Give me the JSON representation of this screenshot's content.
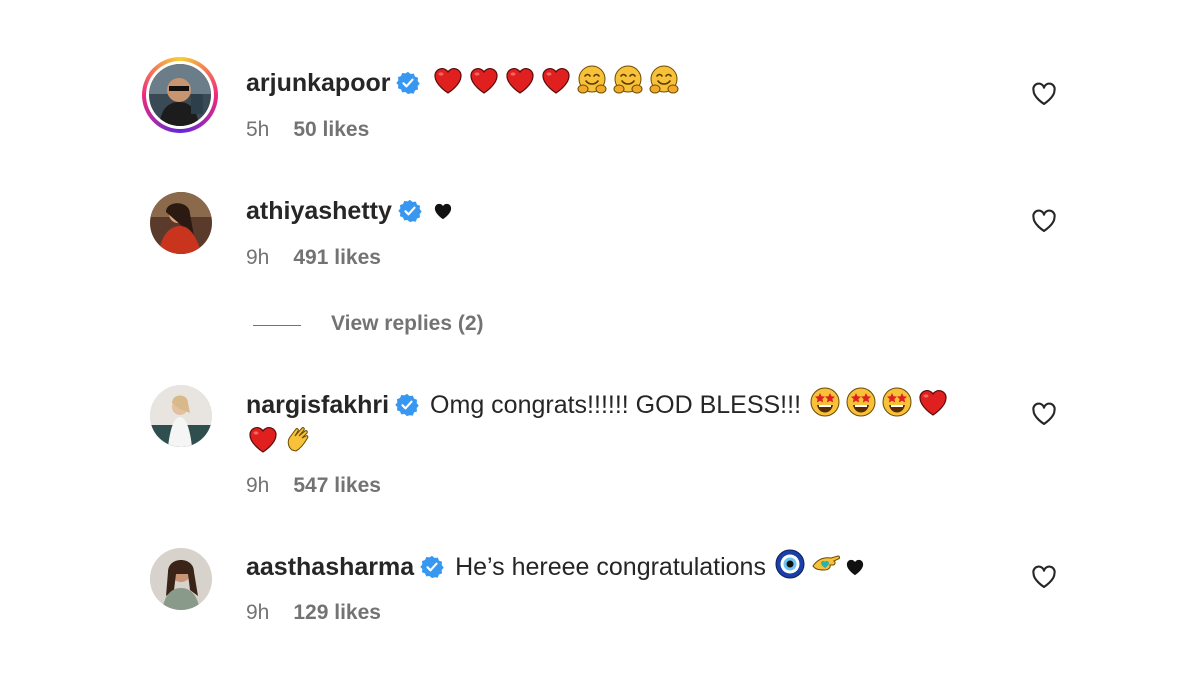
{
  "comments": [
    {
      "username": "arjunkapoor",
      "text": "",
      "time": "5h",
      "likes": "50 likes"
    },
    {
      "username": "athiyashetty",
      "text": "",
      "time": "9h",
      "likes": "491 likes"
    },
    {
      "username": "nargisfakhri",
      "text": "Omg congrats!!!!!! GOD BLESS!!!",
      "time": "9h",
      "likes": "547 likes"
    },
    {
      "username": "aasthasharma",
      "text": "He’s hereee congratulations",
      "time": "9h",
      "likes": "129 likes"
    }
  ],
  "view_replies": "View replies (2)",
  "colors": {
    "verified": "#3897f0",
    "heart_red": "#e0201f",
    "emoji_yellow": "#f7c13a",
    "muted": "#737373"
  }
}
